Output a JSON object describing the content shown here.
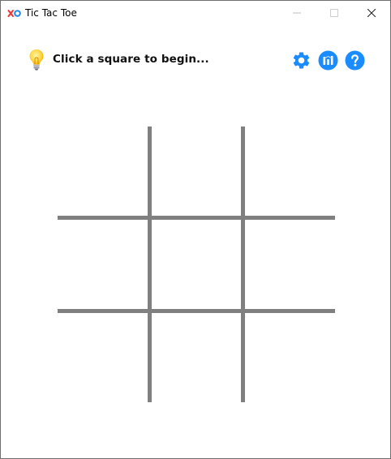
{
  "window": {
    "title": "Tic Tac Toe",
    "controls": [
      "minimize",
      "maximize",
      "close"
    ]
  },
  "header": {
    "status": "Click a square to begin...",
    "status_icon": "lightbulb-icon",
    "actions": [
      {
        "name": "settings",
        "icon": "gear-icon"
      },
      {
        "name": "statistics",
        "icon": "stats-icon"
      },
      {
        "name": "help",
        "icon": "question-mark-icon"
      }
    ]
  },
  "board": {
    "rows": 3,
    "columns": 3,
    "cells": [
      "",
      "",
      "",
      "",
      "",
      "",
      "",
      "",
      ""
    ],
    "line_color": "#808080"
  },
  "colors": {
    "accent": "#1a8cff",
    "logo_x": "#e53935",
    "logo_o": "#1e88e5"
  }
}
